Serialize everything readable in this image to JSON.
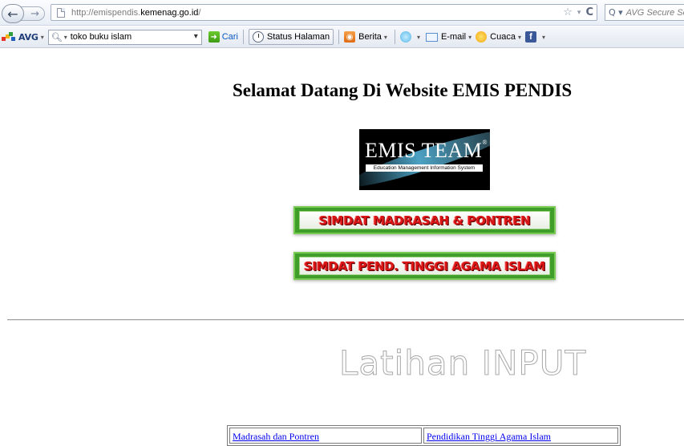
{
  "browser": {
    "url_prefix": "http://emispendis.",
    "url_domain": "kemenag.go.id",
    "url_suffix": "/",
    "star_icon": "☆",
    "dropdown_glyph": "▾",
    "reload_icon": "C",
    "search_engine_icon": "Q ▾",
    "search_placeholder": "AVG Secure Search"
  },
  "toolbar": {
    "brand": "AVG",
    "search_value": "toko buku islam",
    "cari_label": "Cari",
    "status_label": "Status Halaman",
    "berita_label": "Berita",
    "email_label": "E-mail",
    "cuaca_label": "Cuaca",
    "facebook_glyph": "f",
    "menu_caret": "▾"
  },
  "page": {
    "title": "Selamat Datang Di Website EMIS PENDIS",
    "logo": {
      "title": "EMIS TEAM",
      "registered": "®",
      "subtitle": "Education Management Information System"
    },
    "banners": [
      {
        "label": "SIMDAT MADRASAH & PONTREN"
      },
      {
        "label": "SIMDAT PEND. TINGGI AGAMA ISLAM"
      }
    ],
    "section_heading": "Latihan INPUT",
    "links": [
      {
        "label": "Madrasah dan Pontren"
      },
      {
        "label": "Pendidikan Tinggi Agama Islam"
      }
    ]
  },
  "colors": {
    "banner_green": "#3f9d2a",
    "banner_text_red": "#d91515",
    "link_blue": "#0000ee"
  }
}
